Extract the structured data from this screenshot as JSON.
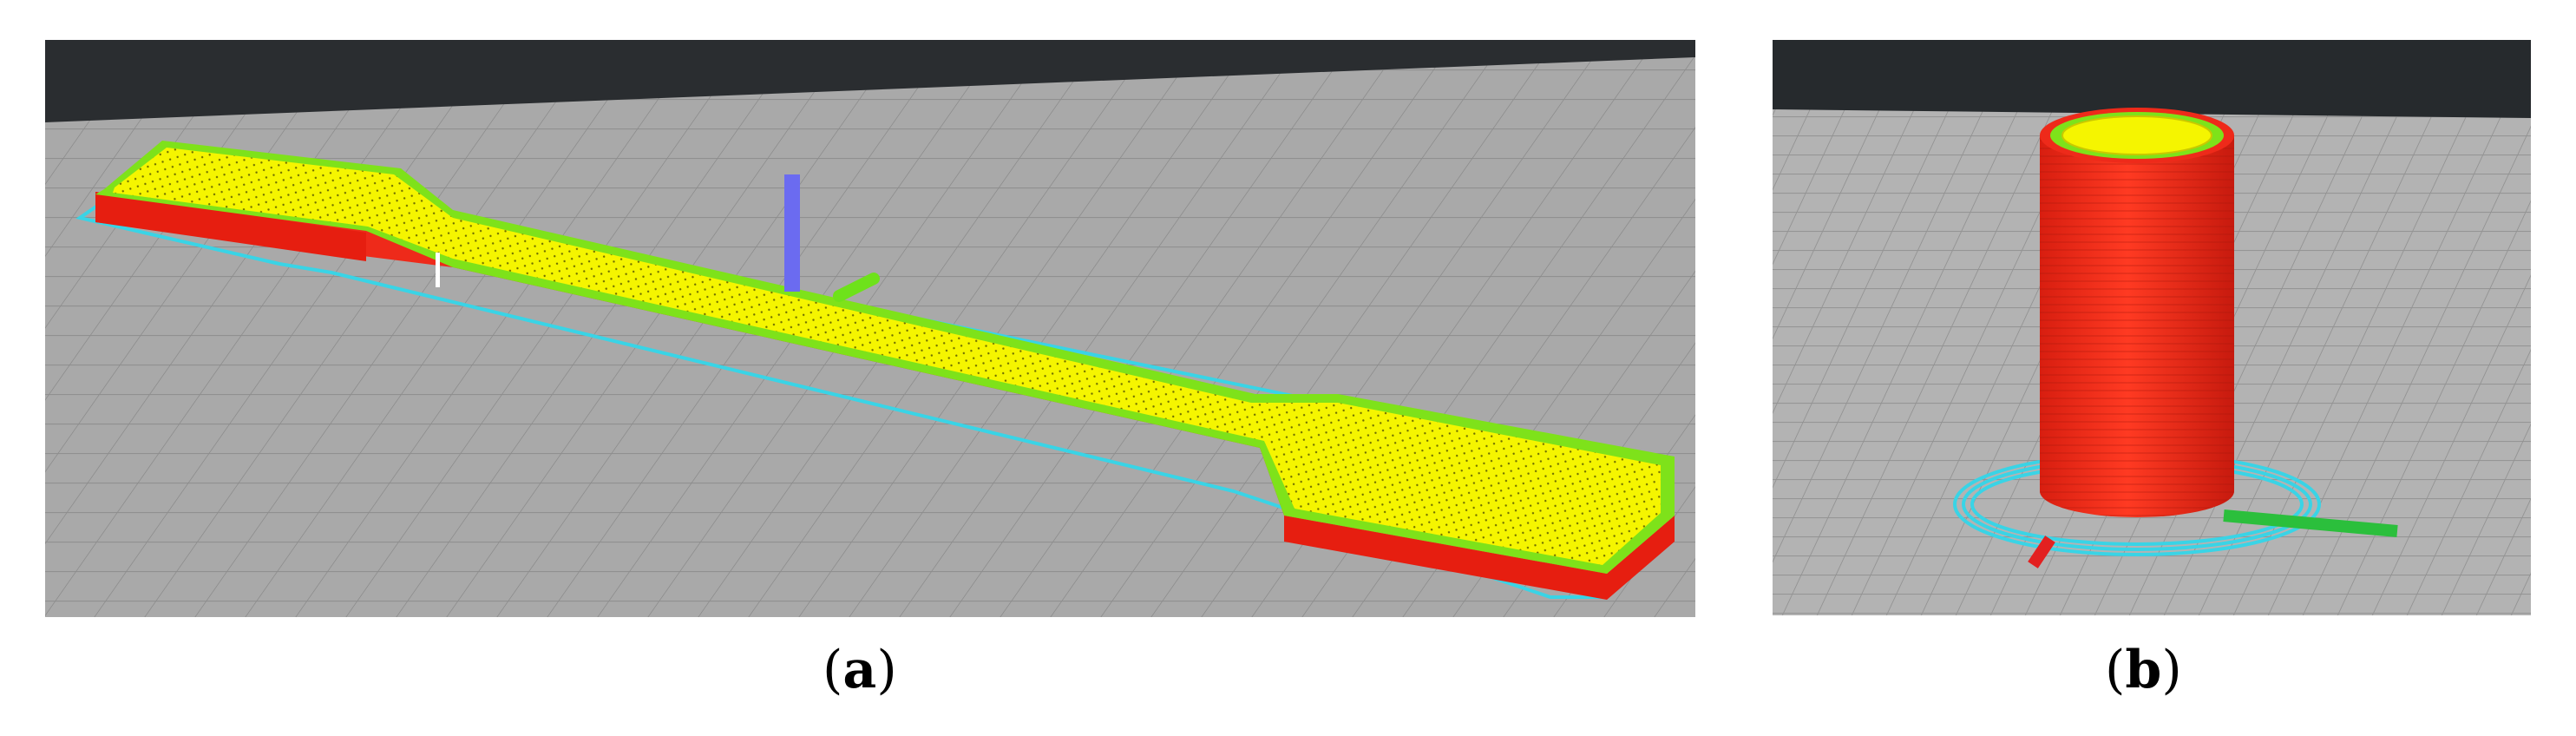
{
  "figure": {
    "panel_a": {
      "label": "a"
    },
    "panel_b": {
      "label": "b"
    }
  },
  "colors": {
    "build_plate": "#a9a9a9",
    "background_dark": "#2a2d30",
    "part_wall": "#ee2a1a",
    "infill": "#f5f500",
    "perimeter": "#7ee21a",
    "skirt": "#39d4e6",
    "axis_z": "#6b6bf0",
    "axis_y": "#2bbf3c",
    "axis_x": "#e32020"
  },
  "icons": [
    "axis-gizmo-icon"
  ]
}
